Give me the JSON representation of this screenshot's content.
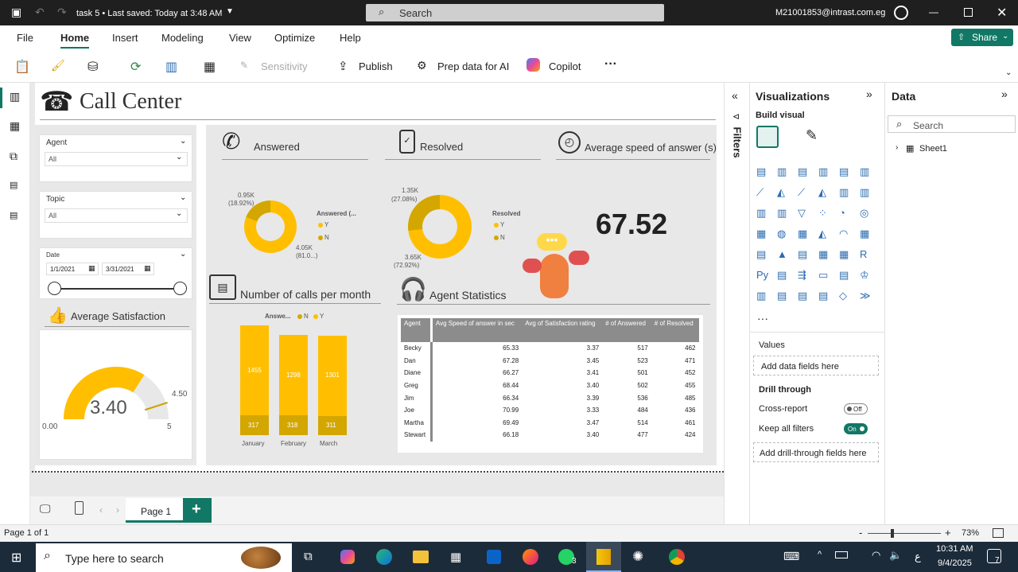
{
  "titlebar": {
    "doc_title": "task 5 • Last saved: Today at 3:48 AM",
    "search_label": "Search",
    "user": "M21001853@intrast.com.eg"
  },
  "menu": {
    "file": "File",
    "home": "Home",
    "insert": "Insert",
    "modeling": "Modeling",
    "view": "View",
    "optimize": "Optimize",
    "help": "Help",
    "share": "Share"
  },
  "toolbar": {
    "sensitivity": "Sensitivity",
    "publish": "Publish",
    "prep": "Prep data for AI",
    "copilot": "Copilot",
    "more": "···"
  },
  "report": {
    "title": "Call Center",
    "slicers": {
      "agent_label": "Agent",
      "agent_value": "All",
      "topic_label": "Topic",
      "topic_value": "All",
      "date_label": "Date",
      "date_from": "1/1/2021",
      "date_to": "3/31/2021"
    },
    "satisfaction": {
      "title": "Average Satisfaction",
      "value": "3.40",
      "min": "0.00",
      "max": "5",
      "target": "4.50",
      "value_fraction": 0.68,
      "target_fraction": 0.9
    },
    "answered": {
      "title": "Answered",
      "legend_title": "Answered (...",
      "legend_y": "Y",
      "legend_n": "N",
      "n_label": "0.95K",
      "n_pct": "(18.92%)",
      "y_label": "4.05K",
      "y_pct": "(81.0...)",
      "y_share": 81.08
    },
    "resolved": {
      "title": "Resolved",
      "legend_title": "Resolved",
      "legend_y": "Y",
      "legend_n": "N",
      "n_label": "1.35K",
      "n_pct": "(27.08%)",
      "y_label": "3.65K",
      "y_pct": "(72.92%)",
      "y_share": 72.92
    },
    "speed": {
      "title": "Average speed of answer (s)",
      "value": "67.52"
    },
    "calls": {
      "title": "Number of calls per month",
      "legend_title": "Answe...",
      "legend_n": "N",
      "legend_y": "Y"
    },
    "agents": {
      "title": "Agent Statistics",
      "headers": [
        "Agent",
        "Avg Speed of answer in sec",
        "Avg of Satisfaction rating",
        "# of Answered",
        "# of Resolved"
      ],
      "rows": [
        [
          "Becky",
          "65.33",
          "3.37",
          "517",
          "462"
        ],
        [
          "Dan",
          "67.28",
          "3.45",
          "523",
          "471"
        ],
        [
          "Diane",
          "66.27",
          "3.41",
          "501",
          "452"
        ],
        [
          "Greg",
          "68.44",
          "3.40",
          "502",
          "455"
        ],
        [
          "Jim",
          "66.34",
          "3.39",
          "536",
          "485"
        ],
        [
          "Joe",
          "70.99",
          "3.33",
          "484",
          "436"
        ],
        [
          "Martha",
          "69.49",
          "3.47",
          "514",
          "461"
        ],
        [
          "Stewart",
          "66.18",
          "3.40",
          "477",
          "424"
        ]
      ]
    }
  },
  "chart_data": {
    "type": "bar",
    "categories": [
      "January",
      "February",
      "March"
    ],
    "series": [
      {
        "name": "N",
        "values": [
          317,
          318,
          311
        ]
      },
      {
        "name": "Y",
        "values": [
          1455,
          1298,
          1301
        ]
      }
    ],
    "stacked": true
  },
  "filters": {
    "label": "Filters"
  },
  "viz": {
    "title": "Visualizations",
    "build": "Build visual",
    "values": "Values",
    "add_fields": "Add data fields here",
    "drill": "Drill through",
    "cross": "Cross-report",
    "cross_state": "Off",
    "keep": "Keep all filters",
    "keep_state": "On",
    "add_drill": "Add drill-through fields here",
    "more": "···"
  },
  "data": {
    "title": "Data",
    "search": "Search",
    "table": "Sheet1"
  },
  "pages": {
    "page1": "Page 1",
    "add": "+"
  },
  "status": {
    "page": "Page 1 of 1",
    "zoom": "73%"
  },
  "taskbar": {
    "search": "Type here to search",
    "time": "10:31 AM",
    "date": "9/4/2025",
    "lang": "ع",
    "notif": "7",
    "badge": "3"
  }
}
